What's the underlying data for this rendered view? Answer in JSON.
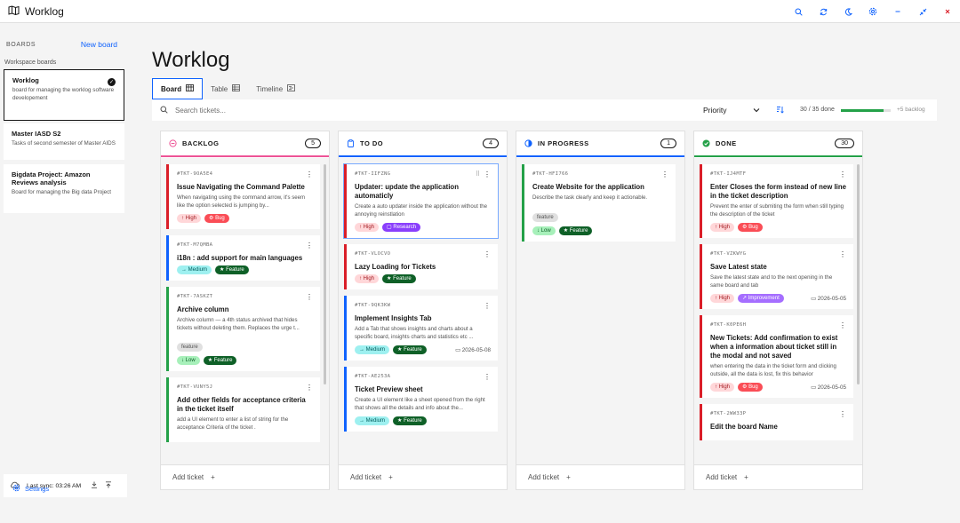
{
  "app": {
    "title": "Worklog"
  },
  "topbar": {
    "icons": [
      "search-icon",
      "sync-icon",
      "moon-icon",
      "settings-icon",
      "minimize-icon",
      "restore-icon",
      "close-icon"
    ]
  },
  "sidebar": {
    "boards_label": "BOARDS",
    "new_board_label": "New board",
    "workspace_label": "Workspace boards",
    "boards": [
      {
        "title": "Worklog",
        "desc": "board for managing the worklog software developement"
      },
      {
        "title": "Master IASD S2",
        "desc": "Tasks of second semester of Master AIDS"
      },
      {
        "title": "Bigdata Project: Amazon Reviews analysis",
        "desc": "Board for managing the Big data Project"
      }
    ],
    "sync_label": "Last sync: 03:26 AM",
    "settings_label": "Settings"
  },
  "main": {
    "title": "Worklog",
    "tabs": [
      {
        "label": "Board"
      },
      {
        "label": "Table"
      },
      {
        "label": "Timeline"
      }
    ],
    "search_placeholder": "Search tickets...",
    "priority_label": "Priority",
    "done_text": "30 / 35 done",
    "done_fraction": 0.857,
    "backlog_text": "+5 backlog",
    "add_ticket_label": "Add ticket"
  },
  "columns": [
    {
      "title": "BACKLOG",
      "count": "5",
      "color": "#ee5396",
      "cards": [
        {
          "id": "#TKT-9OA5E4",
          "title": "Issue Navigating the Command Palette",
          "desc": "When navigating using the command arrow, it's seem like the option selected is jumping by...",
          "priority": "↑ High",
          "ptype": "high",
          "type": "Bug",
          "ttype": "bug",
          "label": "",
          "date": "",
          "accent": "#da1e28"
        },
        {
          "id": "#TKT-M7QMBA",
          "title": "i18n : add support for main languages",
          "desc": "",
          "priority": "→ Medium",
          "ptype": "med",
          "type": "Feature",
          "ttype": "feat",
          "label": "",
          "date": "",
          "accent": "#0f62fe"
        },
        {
          "id": "#TKT-7ASKZT",
          "title": "Archive column",
          "desc": "Archive column — a 4th status archived that hides tickets without deleting them. Replaces the urge t...",
          "priority": "↓ Low",
          "ptype": "low",
          "type": "Feature",
          "ttype": "feat",
          "label": "feature",
          "date": "",
          "accent": "#24a148"
        },
        {
          "id": "#TKT-VUNY5J",
          "title": "Add other fields for acceptance criteria in the ticket itself",
          "desc": "add a UI element to enter a list of string for the acceptance Criteria of the ticket .",
          "priority": "",
          "ptype": "",
          "type": "",
          "ttype": "",
          "label": "",
          "date": "",
          "accent": "#24a148"
        }
      ]
    },
    {
      "title": "TO DO",
      "count": "4",
      "color": "#0f62fe",
      "cards": [
        {
          "id": "#TKT-IIFZNG",
          "title": "Updater: update the application automaticly",
          "desc": "Create a auto updater inside the application without the annoying reinstlation",
          "priority": "↑ High",
          "ptype": "high",
          "type": "Research",
          "ttype": "res",
          "label": "",
          "date": "",
          "accent": "#da1e28"
        },
        {
          "id": "#TKT-VLOCVO",
          "title": "Lazy Loading for Tickets",
          "desc": "",
          "priority": "↑ High",
          "ptype": "high",
          "type": "Feature",
          "ttype": "feat",
          "label": "",
          "date": "",
          "accent": "#da1e28"
        },
        {
          "id": "#TKT-9QK3KW",
          "title": "Implement Insights Tab",
          "desc": "Add a Tab that shows insights and charts about a specific board, insights charts and statistics etc ...",
          "priority": "→ Medium",
          "ptype": "med",
          "type": "Feature",
          "ttype": "feat",
          "label": "",
          "date": "2026-05-08",
          "accent": "#0f62fe"
        },
        {
          "id": "#TKT-AE253A",
          "title": "Ticket Preview sheet",
          "desc": "Create a UI element like a sheet opened from the right that shows all the details and info about the...",
          "priority": "→ Medium",
          "ptype": "med",
          "type": "Feature",
          "ttype": "feat",
          "label": "",
          "date": "",
          "accent": "#0f62fe"
        }
      ]
    },
    {
      "title": "IN PROGRESS",
      "count": "1",
      "color": "#0f62fe",
      "cards": [
        {
          "id": "#TKT-HFI766",
          "title": "Create Website for the application",
          "desc": "Describe the task clearly and keep it actionable.",
          "priority": "↓ Low",
          "ptype": "low",
          "type": "Feature",
          "ttype": "feat",
          "label": "feature",
          "date": "",
          "accent": "#24a148"
        }
      ]
    },
    {
      "title": "DONE",
      "count": "30",
      "color": "#24a148",
      "cards": [
        {
          "id": "#TKT-IJ4MTF",
          "title": "Enter Closes the form instead of new line in the ticket description",
          "desc": "Prevent the enter of submiting the form when still typing the description of the ticket",
          "priority": "↑ High",
          "ptype": "high",
          "type": "Bug",
          "ttype": "bug",
          "label": "",
          "date": "",
          "accent": "#da1e28"
        },
        {
          "id": "#TKT-VZKWYG",
          "title": "Save Latest state",
          "desc": "Save the latest state and to the next opening in the same board and tab",
          "priority": "↑ High",
          "ptype": "high",
          "type": "Improvement",
          "ttype": "imp",
          "label": "",
          "date": "2026-05-05",
          "accent": "#da1e28"
        },
        {
          "id": "#TKT-K0PE6H",
          "title": "New Tickets: Add confirmation to exist when a information about ticket still in the modal and not saved",
          "desc": "when entering the data in the ticket form and clicking outside, all the data is lost, fix this behavior",
          "priority": "↑ High",
          "ptype": "high",
          "type": "Bug",
          "ttype": "bug",
          "label": "",
          "date": "2026-05-05",
          "accent": "#da1e28"
        },
        {
          "id": "#TKT-2WW33P",
          "title": "Edit the board Name",
          "desc": "",
          "priority": "",
          "ptype": "",
          "type": "",
          "ttype": "",
          "label": "",
          "date": "",
          "accent": "#da1e28"
        }
      ]
    }
  ]
}
